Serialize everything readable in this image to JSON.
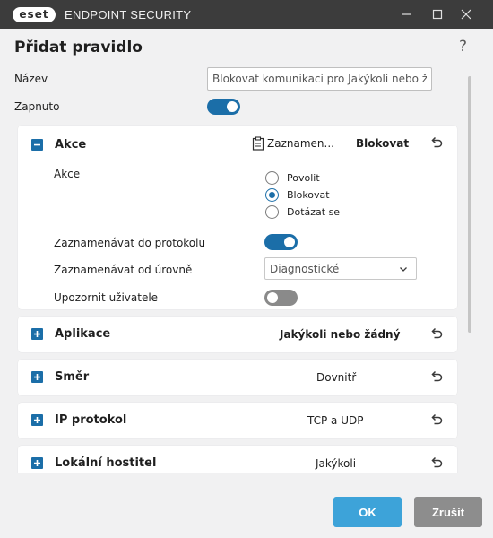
{
  "window": {
    "logo_text": "eset",
    "product_name": "ENDPOINT SECURITY"
  },
  "dialog": {
    "title": "Přidat pravidlo",
    "help": "?"
  },
  "form": {
    "name_label": "Název",
    "name_value": "Blokovat komunikaci pro Jakýkoli nebo žád",
    "enabled_label": "Zapnuto",
    "enabled": true
  },
  "sections": {
    "action": {
      "title": "Akce",
      "log_summary": "Zaznamen...",
      "value": "Blokovat",
      "action_label": "Akce",
      "options": [
        {
          "label": "Povolit",
          "checked": false
        },
        {
          "label": "Blokovat",
          "checked": true
        },
        {
          "label": "Dotázat se",
          "checked": false
        }
      ],
      "log_label": "Zaznamenávat do protokolu",
      "log_enabled": true,
      "level_label": "Zaznamenávat od úrovně",
      "level_value": "Diagnostické",
      "notify_label": "Upozornit uživatele",
      "notify_enabled": false
    },
    "application": {
      "title": "Aplikace",
      "value": "Jakýkoli nebo žádný"
    },
    "direction": {
      "title": "Směr",
      "value": "Dovnitř"
    },
    "ip_protocol": {
      "title": "IP protokol",
      "value": "TCP a UDP"
    },
    "local_host": {
      "title": "Lokální hostitel",
      "value": "Jakýkoli"
    }
  },
  "buttons": {
    "ok": "OK",
    "cancel": "Zrušit"
  },
  "colors": {
    "accent": "#1b6ea8",
    "ok_button": "#3da3d9",
    "cancel_button": "#8d8d8d",
    "titlebar": "#3c3c3c"
  }
}
